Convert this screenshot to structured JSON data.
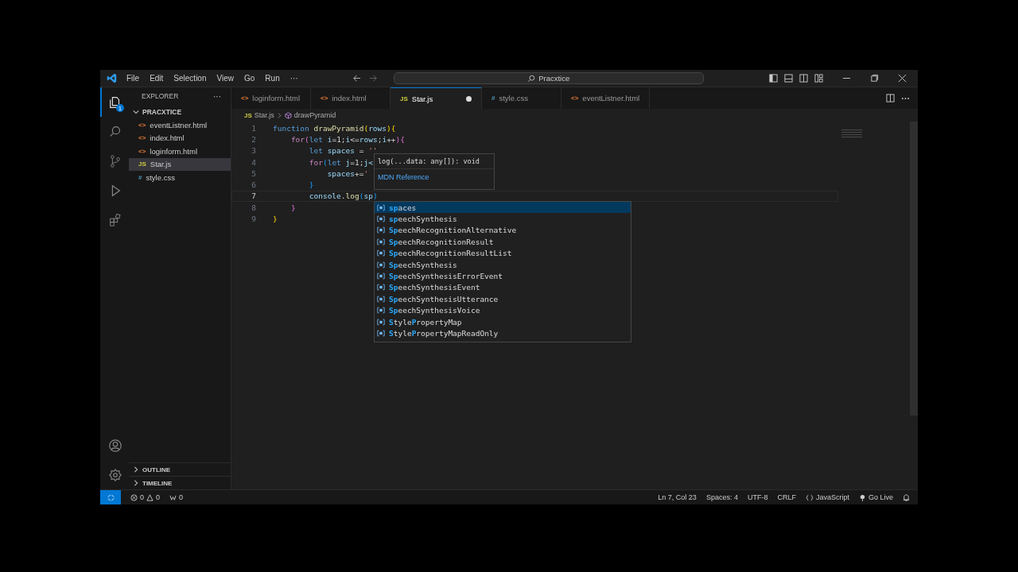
{
  "title_bar": {
    "menu": [
      "File",
      "Edit",
      "Selection",
      "View",
      "Go",
      "Run",
      "···"
    ],
    "search": "Pracxtice"
  },
  "activity_bar": {
    "explorer_badge": "1"
  },
  "sidebar": {
    "title": "EXPLORER",
    "more": "···",
    "folder": {
      "name": "PRACXTICE",
      "expanded": true,
      "files": [
        {
          "name": "eventListner.html",
          "kind": "html",
          "icon": "<>",
          "selected": false
        },
        {
          "name": "index.html",
          "kind": "html",
          "icon": "<>",
          "selected": false
        },
        {
          "name": "loginform.html",
          "kind": "html",
          "icon": "<>",
          "selected": false
        },
        {
          "name": "Star.js",
          "kind": "js",
          "icon": "JS",
          "selected": true
        },
        {
          "name": "style.css",
          "kind": "css",
          "icon": "#",
          "selected": false
        }
      ]
    },
    "sections": [
      {
        "label": "OUTLINE",
        "expanded": false
      },
      {
        "label": "TIMELINE",
        "expanded": false
      }
    ]
  },
  "tabs": [
    {
      "label": "loginform.html",
      "kind": "html",
      "icon": "<>",
      "selected": false,
      "modified": false
    },
    {
      "label": "index.html",
      "kind": "html",
      "icon": "<>",
      "selected": false,
      "modified": false
    },
    {
      "label": "Star.js",
      "kind": "js",
      "icon": "JS",
      "selected": true,
      "modified": true
    },
    {
      "label": "style.css",
      "kind": "css",
      "icon": "#",
      "selected": false,
      "modified": false
    },
    {
      "label": "eventListner.html",
      "kind": "html",
      "icon": "<>",
      "selected": false,
      "modified": false
    }
  ],
  "breadcrumb": {
    "icon": "JS",
    "file": "Star.js",
    "symbol": "drawPyramid"
  },
  "code": [
    {
      "number": "1",
      "current": false,
      "tokens": [
        {
          "text": "function ",
          "kind": "keyword"
        },
        {
          "text": "drawPyramid",
          "kind": "func"
        },
        {
          "text": "(",
          "kind": "bracket"
        },
        {
          "text": "rows",
          "kind": "param"
        },
        {
          "text": "){",
          "kind": "bracket"
        }
      ]
    },
    {
      "number": "2",
      "current": false,
      "tokens": [
        {
          "text": "    for",
          "kind": "control"
        },
        {
          "text": "(",
          "kind": "bracket2"
        },
        {
          "text": "let ",
          "kind": "keyword"
        },
        {
          "text": "i",
          "kind": "param"
        },
        {
          "text": "=1;",
          "kind": "plain"
        },
        {
          "text": "i",
          "kind": "param"
        },
        {
          "text": "<=",
          "kind": "plain"
        },
        {
          "text": "rows",
          "kind": "param"
        },
        {
          "text": ";",
          "kind": "plain"
        },
        {
          "text": "i",
          "kind": "param"
        },
        {
          "text": "++",
          "kind": "plain"
        },
        {
          "text": "){",
          "kind": "bracket2"
        }
      ]
    },
    {
      "number": "3",
      "current": false,
      "tokens": [
        {
          "text": "        let ",
          "kind": "keyword"
        },
        {
          "text": "spaces",
          "kind": "param"
        },
        {
          "text": " = ",
          "kind": "plain"
        },
        {
          "text": "''",
          "kind": "string"
        }
      ]
    },
    {
      "number": "4",
      "current": false,
      "tokens": [
        {
          "text": "        for",
          "kind": "control"
        },
        {
          "text": "(",
          "kind": "bracket3"
        },
        {
          "text": "let ",
          "kind": "keyword"
        },
        {
          "text": "j",
          "kind": "param"
        },
        {
          "text": "=1;",
          "kind": "plain"
        },
        {
          "text": "j<",
          "kind": "param"
        }
      ]
    },
    {
      "number": "5",
      "current": false,
      "tokens": [
        {
          "text": "            spaces",
          "kind": "param"
        },
        {
          "text": "+=",
          "kind": "plain"
        },
        {
          "text": "'",
          "kind": "string"
        }
      ]
    },
    {
      "number": "6",
      "current": false,
      "tokens": [
        {
          "text": "        }",
          "kind": "bracket3"
        }
      ]
    },
    {
      "number": "7",
      "current": true,
      "tokens": [
        {
          "text": "        console",
          "kind": "param"
        },
        {
          "text": ".",
          "kind": "plain"
        },
        {
          "text": "log",
          "kind": "func"
        },
        {
          "text": "(",
          "kind": "bracket3"
        },
        {
          "text": "sp",
          "kind": "param"
        },
        {
          "text": ")",
          "kind": "bracket3"
        }
      ]
    },
    {
      "number": "8",
      "current": false,
      "tokens": [
        {
          "text": "    }",
          "kind": "bracket2"
        }
      ]
    },
    {
      "number": "9",
      "current": false,
      "tokens": [
        {
          "text": "}",
          "kind": "bracket"
        }
      ]
    }
  ],
  "hover": {
    "signature": "log(...data: any[]): void",
    "link": "MDN Reference"
  },
  "suggestions": [
    {
      "match": "sp",
      "rest": "aces",
      "selected": true
    },
    {
      "match": "sp",
      "rest": "eechSynthesis",
      "selected": false
    },
    {
      "match": "Sp",
      "rest": "eechRecognitionAlternative",
      "selected": false
    },
    {
      "match": "Sp",
      "rest": "eechRecognitionResult",
      "selected": false
    },
    {
      "match": "Sp",
      "rest": "eechRecognitionResultList",
      "selected": false
    },
    {
      "match": "Sp",
      "rest": "eechSynthesis",
      "selected": false
    },
    {
      "match": "Sp",
      "rest": "eechSynthesisErrorEvent",
      "selected": false
    },
    {
      "match": "Sp",
      "rest": "eechSynthesisEvent",
      "selected": false
    },
    {
      "match": "Sp",
      "rest": "eechSynthesisUtterance",
      "selected": false
    },
    {
      "match": "Sp",
      "rest": "eechSynthesisVoice",
      "selected": false
    },
    {
      "match": "S",
      "mid": "tyle",
      "match2": "P",
      "rest": "ropertyMap",
      "selected": false
    },
    {
      "match": "S",
      "mid": "tyle",
      "match2": "P",
      "rest": "ropertyMapReadOnly",
      "selected": false
    }
  ],
  "status_bar": {
    "errors": "0",
    "warnings": "0",
    "ports": "0",
    "position": "Ln 7, Col 23",
    "spaces": "Spaces: 4",
    "encoding": "UTF-8",
    "eol": "CRLF",
    "language": "JavaScript",
    "go_live": "Go Live"
  }
}
